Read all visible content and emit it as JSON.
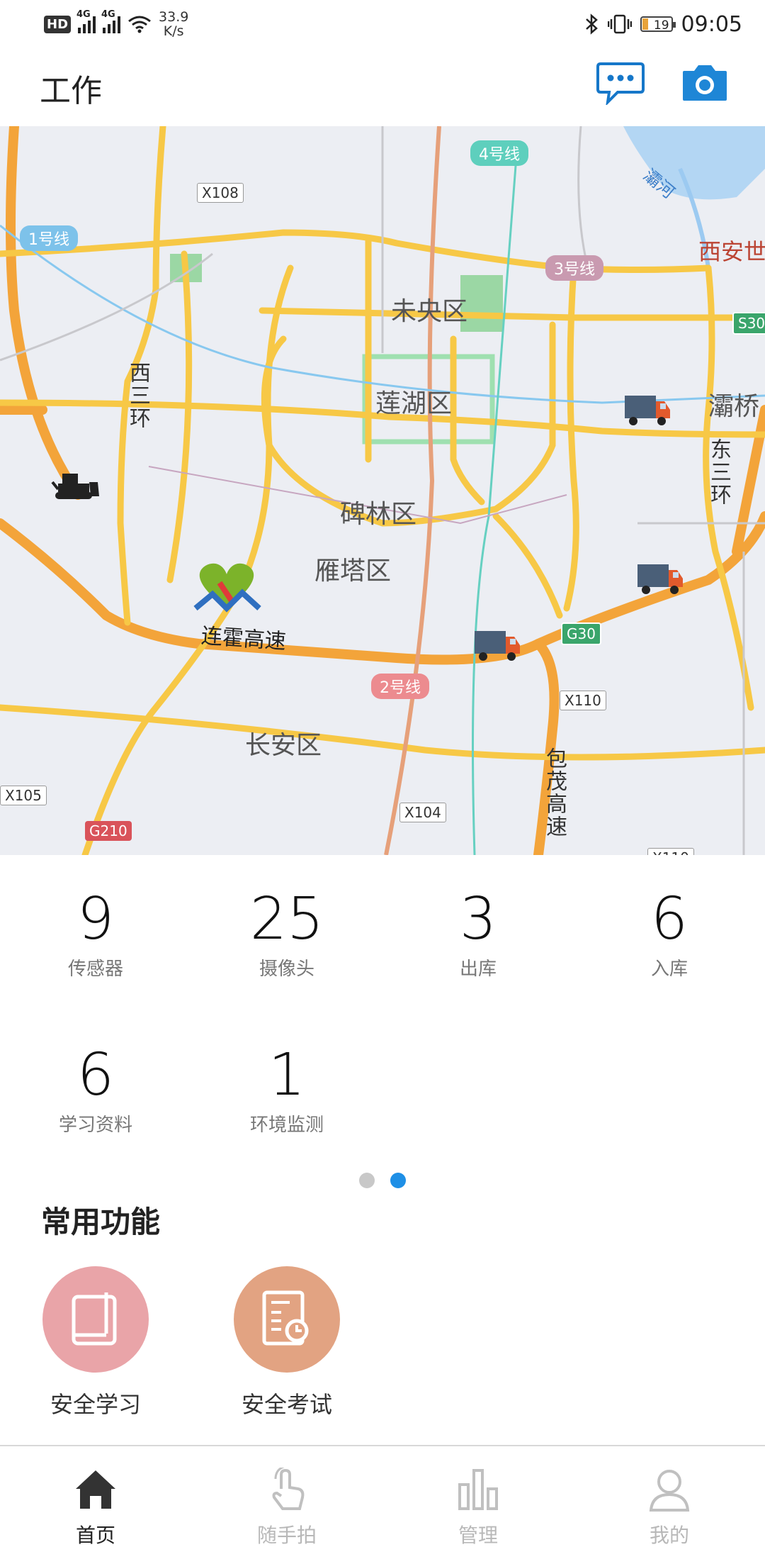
{
  "status_bar": {
    "hd": "HD",
    "net1": "4G",
    "net2": "4G",
    "speed_value": "33.9",
    "speed_unit": "K/s",
    "battery": "19",
    "time": "09:05"
  },
  "app_bar": {
    "title": "工作",
    "icons": [
      "chat-bubble-icon",
      "camera-icon"
    ]
  },
  "map": {
    "districts": [
      "未央区",
      "莲湖区",
      "碑林区",
      "雁塔区",
      "长安区",
      "灞桥"
    ],
    "poi": "西安世",
    "river": "灞河",
    "roads": {
      "west_ring": "西三环",
      "east_ring": "东三环",
      "baomao": "包茂高速",
      "lianhuo": "连霍高速"
    },
    "road_tags": [
      "X108",
      "X110",
      "X105",
      "X104",
      "X110"
    ],
    "red_tags": [
      "G210"
    ],
    "green_tags": [
      "G30",
      "S30"
    ],
    "metro": [
      "1号线",
      "2号线",
      "3号线",
      "4号线"
    ],
    "markers": [
      "truck-icon",
      "truck-icon",
      "truck-icon",
      "bulldozer-icon",
      "company-logo-icon"
    ]
  },
  "stats": [
    {
      "value": "9",
      "label": "传感器"
    },
    {
      "value": "25",
      "label": "摄像头"
    },
    {
      "value": "3",
      "label": "出库"
    },
    {
      "value": "6",
      "label": "入库"
    },
    {
      "value": "6",
      "label": "学习资料"
    },
    {
      "value": "1",
      "label": "环境监测"
    }
  ],
  "pager": {
    "count": 2,
    "active_index": 1
  },
  "common_functions": {
    "title": "常用功能",
    "items": [
      {
        "label": "安全学习",
        "icon": "book-icon",
        "color": "#e9a4a8"
      },
      {
        "label": "安全考试",
        "icon": "exam-paper-icon",
        "color": "#e2a382"
      }
    ]
  },
  "bottom_nav": [
    {
      "label": "首页",
      "icon": "home-icon",
      "active": true
    },
    {
      "label": "随手拍",
      "icon": "touch-hand-icon",
      "active": false
    },
    {
      "label": "管理",
      "icon": "bar-chart-icon",
      "active": false
    },
    {
      "label": "我的",
      "icon": "user-icon",
      "active": false
    }
  ],
  "colors": {
    "accent": "#1e8fe6",
    "chat_icon": "#1677c9",
    "camera_icon": "#1e86d6",
    "nav_active": "#333333",
    "nav_inactive": "#c0c0c0"
  }
}
